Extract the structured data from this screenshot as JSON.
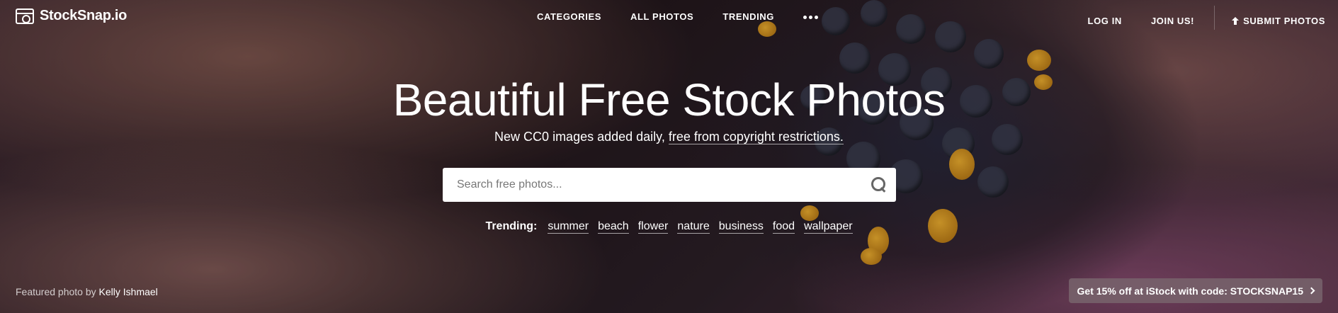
{
  "brand": {
    "name": "StockSnap.io",
    "icon": "camera-icon"
  },
  "nav": {
    "center": [
      "CATEGORIES",
      "ALL PHOTOS",
      "TRENDING"
    ],
    "more_icon": "more-dots-icon",
    "login": "LOG IN",
    "join": "JOIN US!",
    "submit": "SUBMIT PHOTOS",
    "submit_icon": "upload-icon"
  },
  "hero": {
    "title": "Beautiful Free Stock Photos",
    "subtitle_prefix": "New CC0 images added daily,",
    "subtitle_link": "free from copyright restrictions."
  },
  "search": {
    "placeholder": "Search free photos...",
    "icon": "search-icon"
  },
  "trending": {
    "label": "Trending:",
    "tags": [
      "summer",
      "beach",
      "flower",
      "nature",
      "business",
      "food",
      "wallpaper"
    ]
  },
  "credit": {
    "prefix": "Featured photo by",
    "author": "Kelly Ishmael"
  },
  "promo": {
    "text": "Get 15% off at iStock with code: STOCKSNAP15",
    "icon": "chevron-right-icon"
  }
}
